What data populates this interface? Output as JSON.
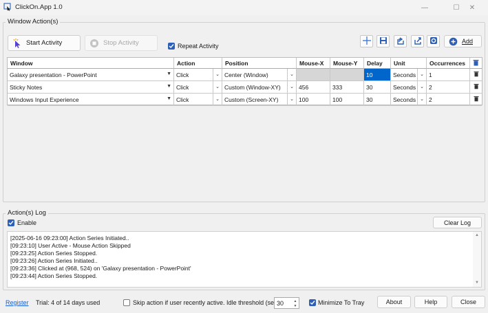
{
  "window": {
    "title": "ClickOn.App 1.0",
    "minimize_glyph": "—",
    "maximize_glyph": "☐",
    "close_glyph": "✕"
  },
  "actions_group": {
    "label": "Window Action(s)",
    "start_label": "Start Activity",
    "stop_label": "Stop Activity",
    "repeat_label": "Repeat Activity",
    "repeat_checked": true,
    "add_label": "Add",
    "toolbar_icons": [
      "crosshair-icon",
      "save-icon",
      "import-icon",
      "export-icon",
      "settings-icon",
      "add-icon"
    ]
  },
  "grid": {
    "headers": [
      "Window",
      "Action",
      "Position",
      "Mouse-X",
      "Mouse-Y",
      "Delay",
      "Unit",
      "Occurrences"
    ],
    "rows": [
      {
        "window": "Galaxy presentation - PowerPoint",
        "action": "Click",
        "position": "Center (Window)",
        "mouse_x": "",
        "mouse_y": "",
        "delay": "10",
        "unit": "Seconds",
        "occurrences": "1"
      },
      {
        "window": "Sticky Notes",
        "action": "Click",
        "position": "Custom (Window-XY)",
        "mouse_x": "456",
        "mouse_y": "333",
        "delay": "30",
        "unit": "Seconds",
        "occurrences": "2"
      },
      {
        "window": "Windows Input Experience",
        "action": "Click",
        "position": "Custom (Screen-XY)",
        "mouse_x": "100",
        "mouse_y": "100",
        "delay": "30",
        "unit": "Seconds",
        "occurrences": "2"
      }
    ]
  },
  "log_group": {
    "label": "Action(s) Log",
    "enable_label": "Enable",
    "enable_checked": true,
    "clear_label": "Clear Log",
    "lines": [
      "[2025-06-16 09:23:00] Action Series Initiated..",
      "[09:23:10] User Active - Mouse Action Skipped",
      "[09:23:25] Action Series Stopped.",
      "[09:23:26] Action Series Initiated..",
      "[09:23:36] Clicked at (968, 524) on 'Galaxy presentation - PowerPoint'",
      "[09:23:44] Action Series Stopped."
    ]
  },
  "footer": {
    "register_label": "Register",
    "trial_text": "Trial: 4 of 14 days used",
    "skip_label": "Skip action if user recently active. Idle threshold (secs)",
    "skip_checked": false,
    "idle_threshold": "30",
    "minimize_tray_label": "Minimize To Tray",
    "minimize_tray_checked": true,
    "about_label": "About",
    "help_label": "Help",
    "close_label": "Close"
  },
  "colors": {
    "accent": "#2c5fb8",
    "selected_cell": "#0066cc",
    "link": "#1a5fd6"
  }
}
